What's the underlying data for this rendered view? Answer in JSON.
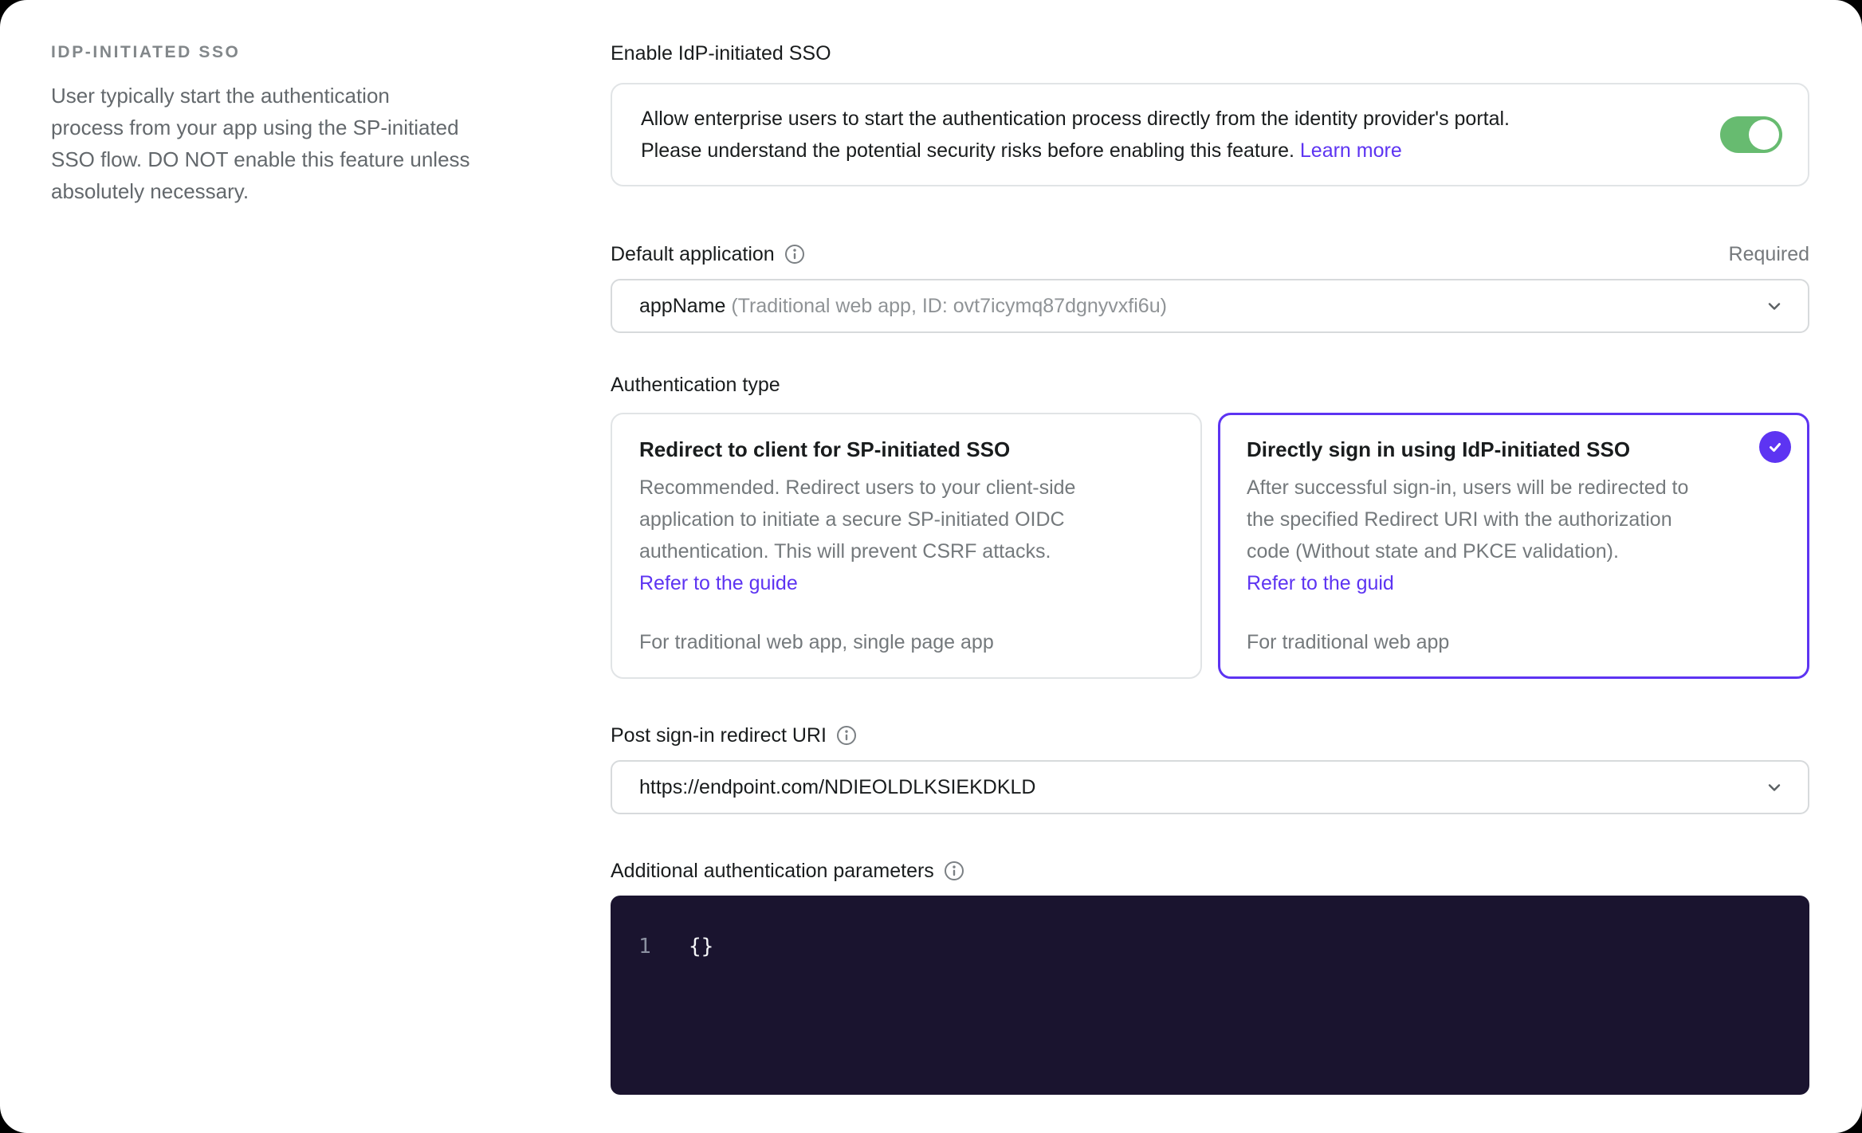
{
  "sidebar": {
    "title": "IDP-INITIATED SSO",
    "description_lines": [
      "User typically start the authentication",
      "process from your app using the SP-initiated",
      "SSO flow. DO NOT enable this feature unless",
      "absolutely necessary."
    ]
  },
  "enable": {
    "label": "Enable IdP-initiated SSO",
    "line1": "Allow enterprise users to start the authentication process directly from the identity provider's portal.",
    "line2": "Please understand the potential security risks before enabling this feature.",
    "learn_more_label": "Learn more",
    "toggle_state": "on"
  },
  "default_application": {
    "label": "Default application",
    "required_label": "Required",
    "value": "appName",
    "value_detail": "(Traditional web app, ID: ovt7icymq87dgnyvxfi6u)"
  },
  "authentication_type": {
    "label": "Authentication type",
    "options": [
      {
        "title": "Redirect to client for SP-initiated SSO",
        "description_lines": [
          "Recommended. Redirect users to your client-side",
          "application to initiate a secure SP-initiated OIDC",
          "authentication. This will prevent CSRF attacks."
        ],
        "link_label": "Refer to the guide",
        "footnote": "For traditional web app, single page app",
        "selected": false
      },
      {
        "title": "Directly sign in using IdP-initiated SSO",
        "description_lines": [
          "After successful sign-in, users will be redirected to",
          "the specified Redirect URI with the authorization",
          "code (Without state and PKCE validation)."
        ],
        "link_label": "Refer to the guid",
        "footnote": "For traditional web app",
        "selected": true
      }
    ]
  },
  "post_redirect_uri": {
    "label": "Post sign-in redirect URI",
    "value": "https://endpoint.com/NDIEOLDLKSIEKDKLD"
  },
  "additional_params": {
    "label": "Additional authentication parameters",
    "lines": [
      {
        "number": "1",
        "code": "{}"
      }
    ]
  },
  "colors": {
    "accent": "#5d34f2",
    "toggle_on": "#67bb70",
    "editor_background": "#1a142f",
    "link": "#5d34f2"
  }
}
